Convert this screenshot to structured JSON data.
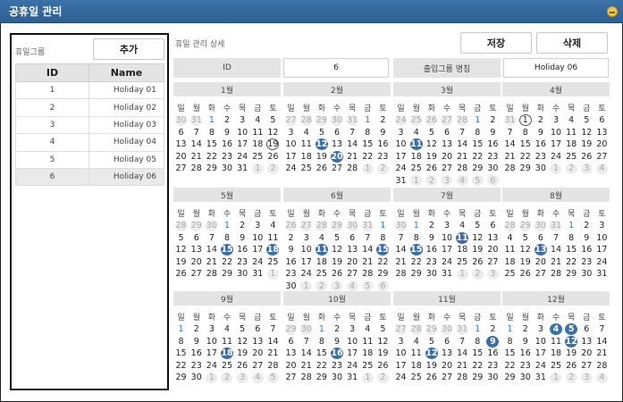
{
  "window": {
    "title": "공휴일 관리"
  },
  "left": {
    "title": "휴일그룹",
    "add_label": "추가",
    "headers": {
      "id": "ID",
      "name": "Name"
    },
    "rows": [
      {
        "id": "1",
        "name": "Holiday 01"
      },
      {
        "id": "2",
        "name": "Holiday 02"
      },
      {
        "id": "3",
        "name": "Holiday 03"
      },
      {
        "id": "4",
        "name": "Holiday 04"
      },
      {
        "id": "5",
        "name": "Holiday 05"
      },
      {
        "id": "6",
        "name": "Holiday 06"
      }
    ],
    "selected_index": 5
  },
  "right": {
    "title": "휴일 관리 상세",
    "save_label": "저장",
    "delete_label": "삭제",
    "id_label": "ID",
    "id_value": "6",
    "name_label": "출입그룹 명칭",
    "name_value": "Holiday 06"
  },
  "weekdays": [
    "일",
    "월",
    "화",
    "수",
    "목",
    "금",
    "토"
  ],
  "colors": {
    "accent": "#3a6fa8",
    "titlebar": "#3b72a8",
    "blue_day": "#2a7ad0"
  },
  "months": [
    {
      "label": "1월",
      "first_dow": 2,
      "days": 31,
      "prev_days": 31,
      "holidays": [],
      "today": 19
    },
    {
      "label": "2월",
      "first_dow": 5,
      "days": 28,
      "prev_days": 31,
      "holidays": [
        12,
        20
      ]
    },
    {
      "label": "3월",
      "first_dow": 5,
      "days": 31,
      "prev_days": 28,
      "holidays": [
        11
      ]
    },
    {
      "label": "4월",
      "first_dow": 1,
      "days": 30,
      "prev_days": 31,
      "holidays": [],
      "today": 1
    },
    {
      "label": "5월",
      "first_dow": 3,
      "days": 31,
      "prev_days": 30,
      "holidays": [
        15,
        18
      ]
    },
    {
      "label": "6월",
      "first_dow": 6,
      "days": 30,
      "prev_days": 31,
      "holidays": [
        11,
        15
      ]
    },
    {
      "label": "7월",
      "first_dow": 1,
      "days": 31,
      "prev_days": 30,
      "holidays": [
        11,
        15
      ]
    },
    {
      "label": "8월",
      "first_dow": 4,
      "days": 31,
      "prev_days": 31,
      "holidays": [
        13
      ]
    },
    {
      "label": "9월",
      "first_dow": 0,
      "days": 30,
      "prev_days": 31,
      "holidays": [
        18
      ]
    },
    {
      "label": "10월",
      "first_dow": 2,
      "days": 31,
      "prev_days": 30,
      "holidays": [
        16
      ]
    },
    {
      "label": "11월",
      "first_dow": 5,
      "days": 30,
      "prev_days": 31,
      "holidays": [
        9,
        12
      ]
    },
    {
      "label": "12월",
      "first_dow": 0,
      "days": 31,
      "prev_days": 30,
      "holidays": [
        4,
        5,
        12
      ]
    }
  ]
}
